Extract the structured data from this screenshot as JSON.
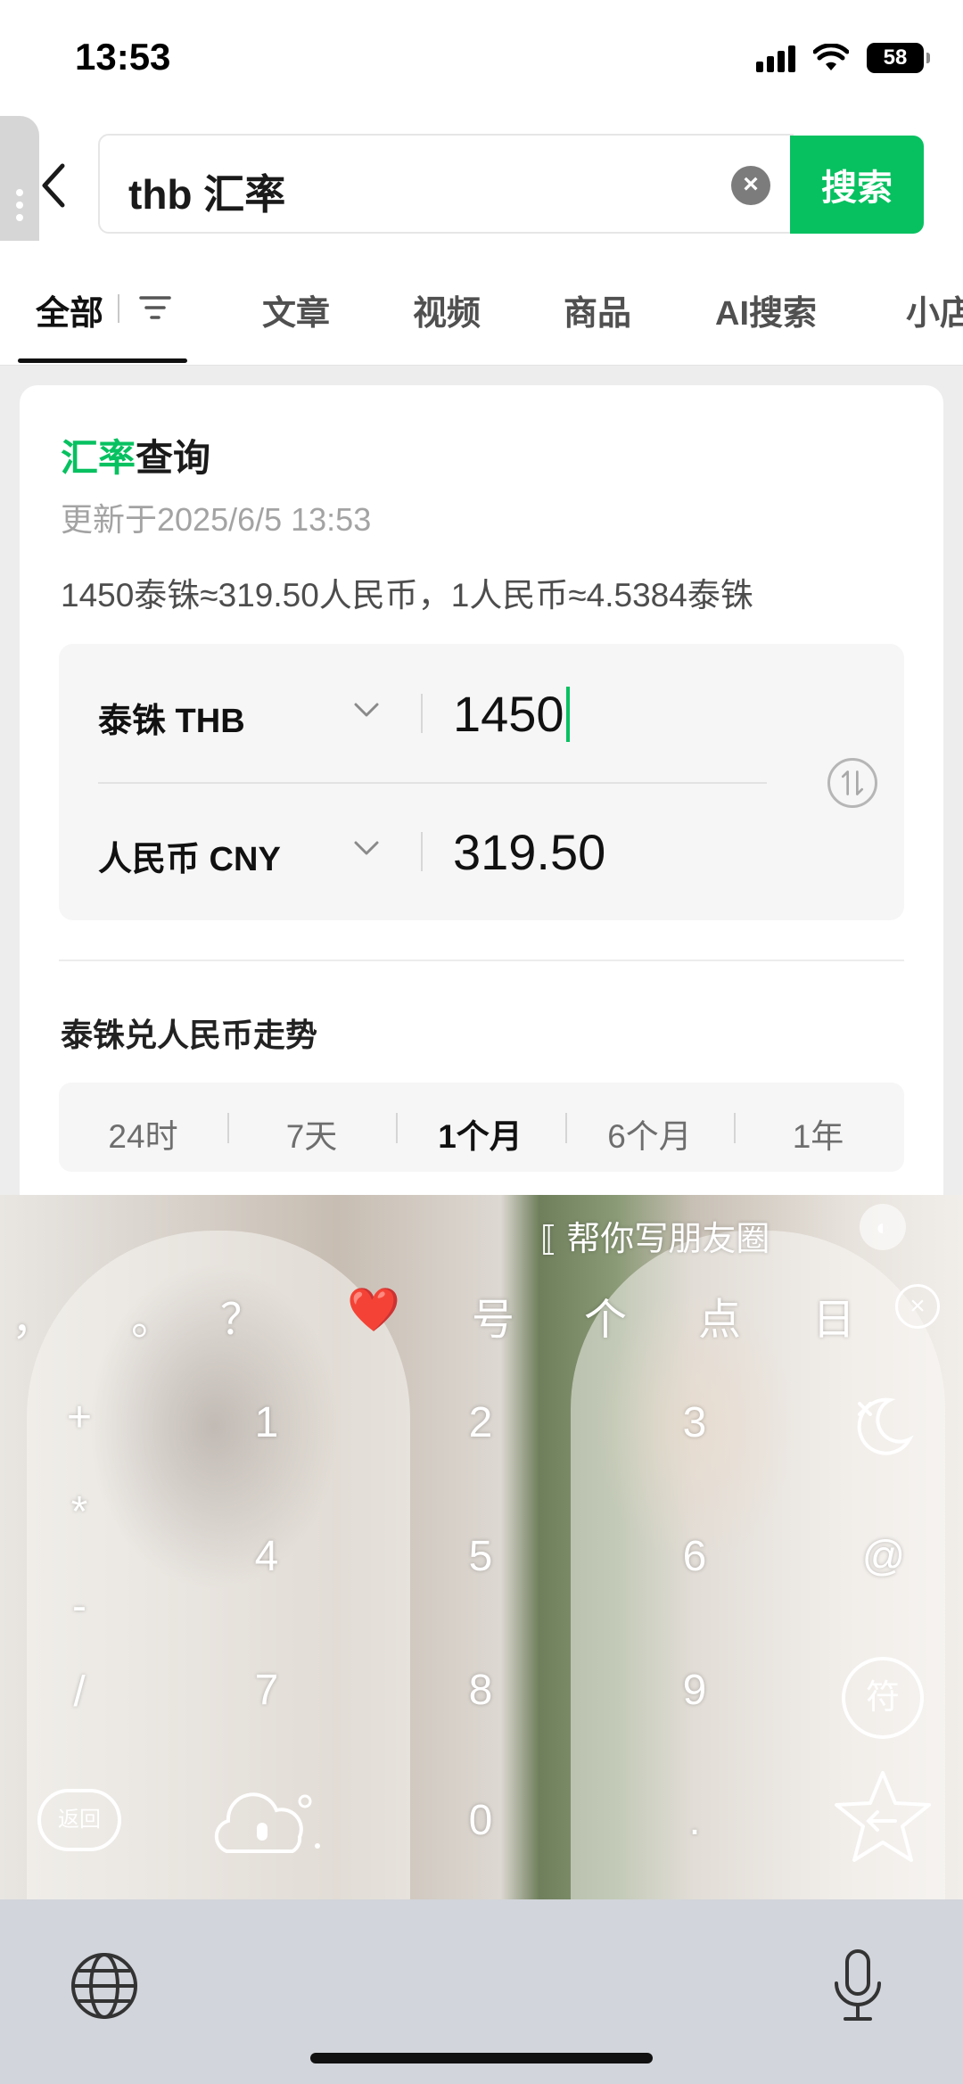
{
  "status_bar": {
    "time": "13:53",
    "battery": "58"
  },
  "search": {
    "query": "thb 汇率",
    "button_label": "搜索"
  },
  "tabs": [
    {
      "label": "全部"
    },
    {
      "label": "文章"
    },
    {
      "label": "视频"
    },
    {
      "label": "商品"
    },
    {
      "label": "AI搜索"
    },
    {
      "label": "小店"
    }
  ],
  "exchange_card": {
    "title_highlight": "汇率",
    "title_rest": "查询",
    "updated": "更新于2025/6/5 13:53",
    "rate_summary": "1450泰铢≈319.50人民币，1人民币≈4.5384泰铢",
    "from_currency": "泰铢 THB",
    "from_amount": "1450",
    "to_currency": "人民币 CNY",
    "to_amount": "319.50",
    "trend_title": "泰铢兑人民币走势",
    "periods": [
      "24时",
      "7天",
      "1个月",
      "6个月",
      "1年"
    ],
    "active_period": "1个月"
  },
  "keyboard": {
    "ai_assist_label": "帮你写朋友圈",
    "suggestions": [
      "，",
      "。",
      "？",
      "❤️",
      "号",
      "个",
      "点",
      "日"
    ],
    "symbol_keys": [
      "+",
      "*",
      "-",
      "/"
    ],
    "digits": [
      "1",
      "2",
      "3",
      "4",
      "5",
      "6",
      "7",
      "8",
      "9",
      "0",
      "."
    ],
    "at_key": "@",
    "symbols_key": "符",
    "back_key": "返回"
  },
  "colors": {
    "accent": "#07c160"
  }
}
